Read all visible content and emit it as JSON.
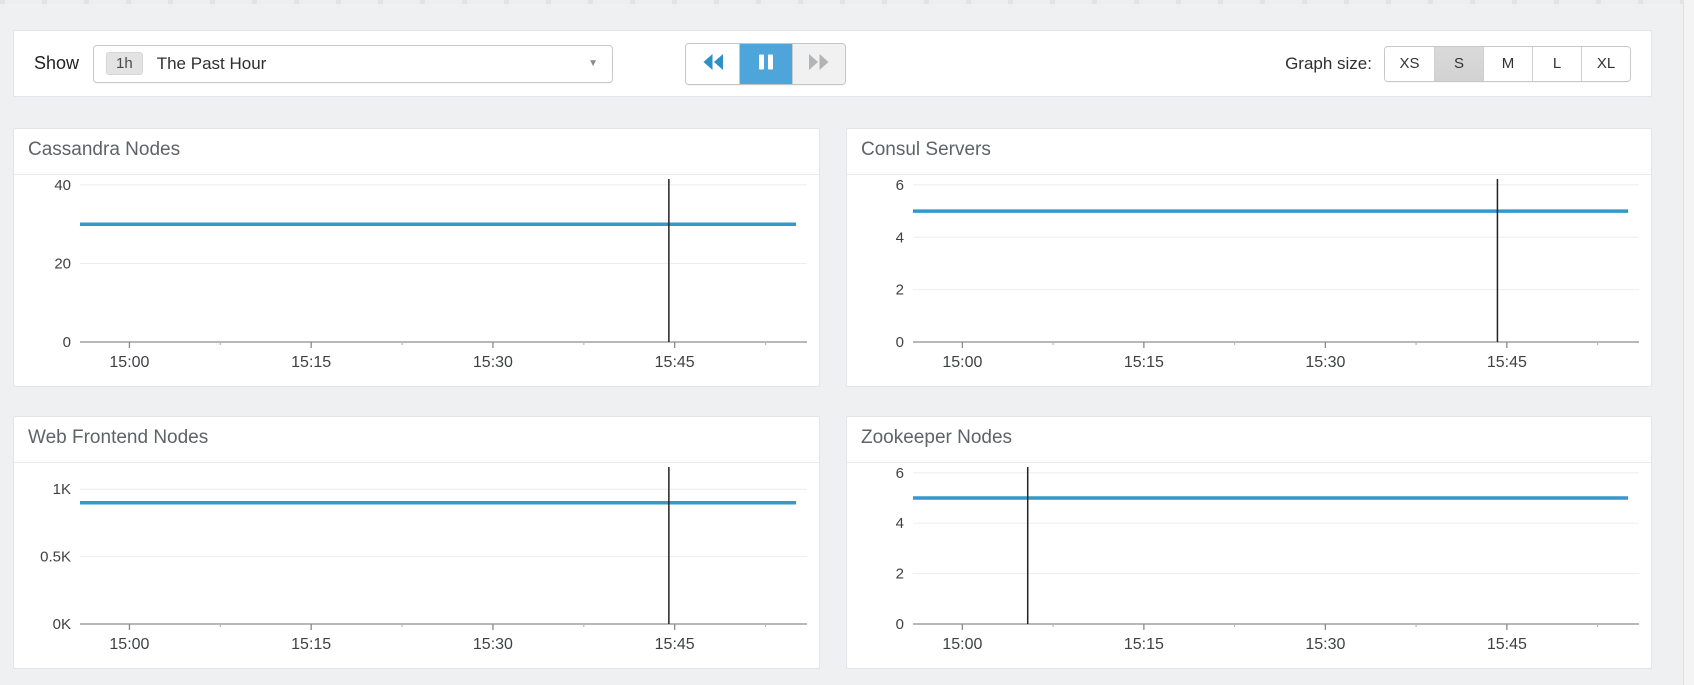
{
  "toolbar": {
    "show_label": "Show",
    "timeframe_badge": "1h",
    "timeframe_label": "The Past Hour",
    "playback": {
      "rewind": "rewind",
      "pause": "pause",
      "forward": "fast-forward",
      "active": "pause"
    },
    "graph_size_label": "Graph size:",
    "sizes": [
      "XS",
      "S",
      "M",
      "L",
      "XL"
    ],
    "selected_size": "S"
  },
  "colors": {
    "accent_blue": "#3399cc",
    "pause_button_bg": "#4ea5d9",
    "selected_size_bg": "#d6d6d6",
    "panel_bg": "#ffffff",
    "page_bg": "#eef0f2",
    "grid_line": "#ededed",
    "axis_line": "#a0a0a0",
    "cursor_line": "#222222"
  },
  "chart_data": [
    {
      "type": "line",
      "title": "Cassandra Nodes",
      "xticks": [
        "15:00",
        "15:15",
        "15:30",
        "15:45"
      ],
      "yticks": [
        0,
        20,
        40
      ],
      "ytick_labels": [
        "0",
        "20",
        "40"
      ],
      "ylim": [
        0,
        41
      ],
      "series": [
        {
          "name": "cassandra nodes",
          "shape": "constant",
          "value": 30
        }
      ],
      "cursor_frac": 0.81,
      "line_end_frac": 0.985,
      "line_color": "#3399cc",
      "legend": "none",
      "grid": "on"
    },
    {
      "type": "line",
      "title": "Consul Servers",
      "xticks": [
        "15:00",
        "15:15",
        "15:30",
        "15:45"
      ],
      "yticks": [
        0,
        2,
        4,
        6
      ],
      "ytick_labels": [
        "0",
        "2",
        "4",
        "6"
      ],
      "ylim": [
        0,
        6.15
      ],
      "series": [
        {
          "name": "consul servers",
          "shape": "constant",
          "value": 5
        }
      ],
      "cursor_frac": 0.805,
      "line_end_frac": 0.985,
      "line_color": "#3399cc",
      "legend": "none",
      "grid": "on"
    },
    {
      "type": "line",
      "title": "Web Frontend Nodes",
      "xticks": [
        "15:00",
        "15:15",
        "15:30",
        "15:45"
      ],
      "yticks": [
        0,
        500,
        1000
      ],
      "ytick_labels": [
        "0K",
        "0.5K",
        "1K"
      ],
      "ylim": [
        0,
        1150
      ],
      "series": [
        {
          "name": "web frontend nodes",
          "shape": "constant",
          "value": 900
        }
      ],
      "cursor_frac": 0.81,
      "line_end_frac": 0.985,
      "line_color": "#3399cc",
      "legend": "none",
      "grid": "on"
    },
    {
      "type": "line",
      "title": "Zookeeper Nodes",
      "xticks": [
        "15:00",
        "15:15",
        "15:30",
        "15:45"
      ],
      "yticks": [
        0,
        2,
        4,
        6
      ],
      "ytick_labels": [
        "0",
        "2",
        "4",
        "6"
      ],
      "ylim": [
        0,
        6.15
      ],
      "series": [
        {
          "name": "zookeeper nodes",
          "shape": "constant",
          "value": 5
        }
      ],
      "cursor_frac": 0.158,
      "line_end_frac": 0.985,
      "line_color": "#3399cc",
      "legend": "none",
      "grid": "on"
    }
  ]
}
